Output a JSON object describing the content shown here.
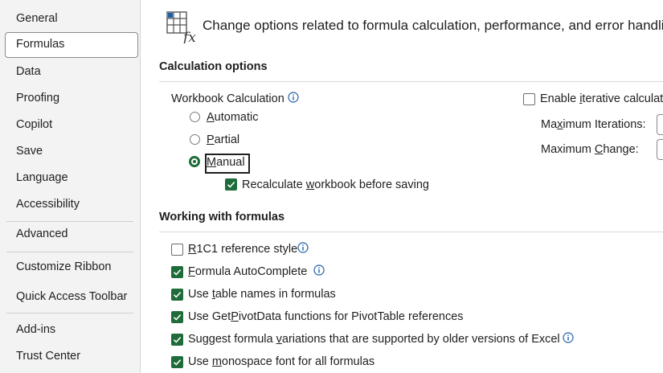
{
  "sidebar": {
    "items": [
      {
        "label": "General"
      },
      {
        "label": "Formulas"
      },
      {
        "label": "Data"
      },
      {
        "label": "Proofing"
      },
      {
        "label": "Copilot"
      },
      {
        "label": "Save"
      },
      {
        "label": "Language"
      },
      {
        "label": "Accessibility"
      },
      {
        "label": "Advanced"
      },
      {
        "label": "Customize Ribbon"
      },
      {
        "label": "Quick Access Toolbar"
      },
      {
        "label": "Add-ins"
      },
      {
        "label": "Trust Center"
      }
    ],
    "selected": "Formulas"
  },
  "header": {
    "text": "Change options related to formula calculation, performance, and error handlin"
  },
  "calculation": {
    "title": "Calculation options",
    "workbook_label": "Workbook Calculation",
    "radios": {
      "automatic": {
        "pre": "",
        "key": "A",
        "post": "utomatic",
        "selected": false
      },
      "partial": {
        "pre": "",
        "key": "P",
        "post": "artial",
        "selected": false
      },
      "manual": {
        "pre": "",
        "key": "M",
        "post": "anual",
        "selected": true
      }
    },
    "recalc": {
      "pre": "Recalculate ",
      "key": "w",
      "post": "orkbook before saving",
      "checked": true
    },
    "iterative": {
      "pre": "Enable ",
      "key": "i",
      "post": "terative calculat",
      "checked": false
    },
    "max_iterations": {
      "pre": "Ma",
      "key": "x",
      "post": "imum Iterations:"
    },
    "max_change": {
      "pre": "Maximum ",
      "key": "C",
      "post": "hange:"
    }
  },
  "formulas": {
    "title": "Working with formulas",
    "items": [
      {
        "pre": "",
        "key": "R",
        "post": "1C1 reference style",
        "checked": false
      },
      {
        "pre": "",
        "key": "F",
        "post": "ormula AutoComplete",
        "checked": true
      },
      {
        "pre": "Use ",
        "key": "t",
        "post": "able names in formulas",
        "checked": true
      },
      {
        "pre": "Use Get",
        "key": "P",
        "post": "ivotData functions for PivotTable references",
        "checked": true
      },
      {
        "pre": "Suggest formula ",
        "key": "v",
        "post": "ariations that are supported by older versions of Excel",
        "checked": true
      },
      {
        "pre": "Use ",
        "key": "m",
        "post": "onospace font for all formulas",
        "checked": true
      }
    ]
  },
  "colors": {
    "accent": "#1e6c3a",
    "info": "#1f5fa8",
    "sidebar_bg": "#f3f3f3"
  }
}
